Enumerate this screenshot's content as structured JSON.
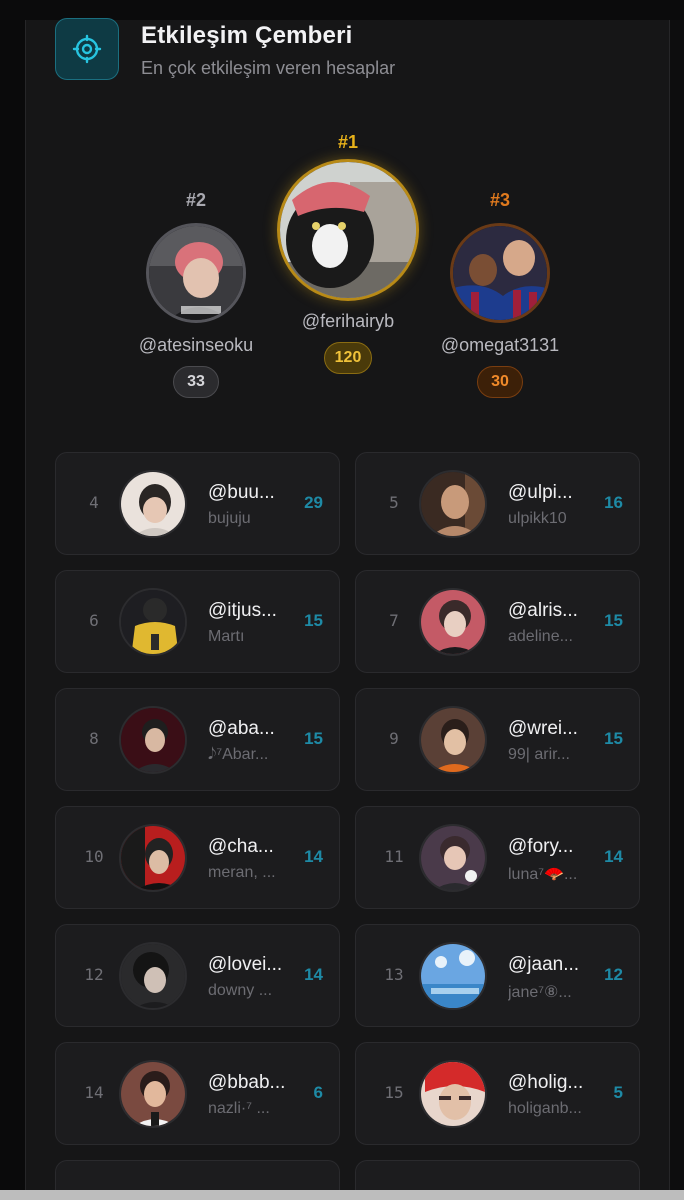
{
  "header": {
    "title": "Etkileşim Çemberi",
    "subtitle": "En çok etkileşim veren hesaplar",
    "icon": "target-circle-icon"
  },
  "podium": {
    "first": {
      "rank": "#1",
      "handle": "@ferihairyb",
      "count": "120",
      "color": "#e8b21a"
    },
    "second": {
      "rank": "#2",
      "handle": "@atesinseoku",
      "count": "33",
      "color": "#a9a9b0"
    },
    "third": {
      "rank": "#3",
      "handle": "@omegat3131",
      "count": "30",
      "color": "#e07a1e"
    }
  },
  "list": [
    {
      "rank": "4",
      "handle": "@buu...",
      "name": "bujuju",
      "count": "29"
    },
    {
      "rank": "5",
      "handle": "@ulpi...",
      "name": "ulpikk10",
      "count": "16"
    },
    {
      "rank": "6",
      "handle": "@itjus...",
      "name": "Martı",
      "count": "15"
    },
    {
      "rank": "7",
      "handle": "@alris...",
      "name": "adeline...",
      "count": "15"
    },
    {
      "rank": "8",
      "handle": "@aba...",
      "name": "𝅘𝅥𝅮⁷Abar...",
      "count": "15"
    },
    {
      "rank": "9",
      "handle": "@wrei...",
      "name": "99| arir...",
      "count": "15"
    },
    {
      "rank": "10",
      "handle": "@cha...",
      "name": "meran, ...",
      "count": "14"
    },
    {
      "rank": "11",
      "handle": "@fory...",
      "name": "luna⁷🪭...",
      "count": "14"
    },
    {
      "rank": "12",
      "handle": "@lovei...",
      "name": "downy ...",
      "count": "14"
    },
    {
      "rank": "13",
      "handle": "@jaan...",
      "name": "jane⁷⑧...",
      "count": "12"
    },
    {
      "rank": "14",
      "handle": "@bbab...",
      "name": "nazli·⁷ ...",
      "count": "6"
    },
    {
      "rank": "15",
      "handle": "@holig...",
      "name": "holiganb...",
      "count": "5"
    }
  ]
}
